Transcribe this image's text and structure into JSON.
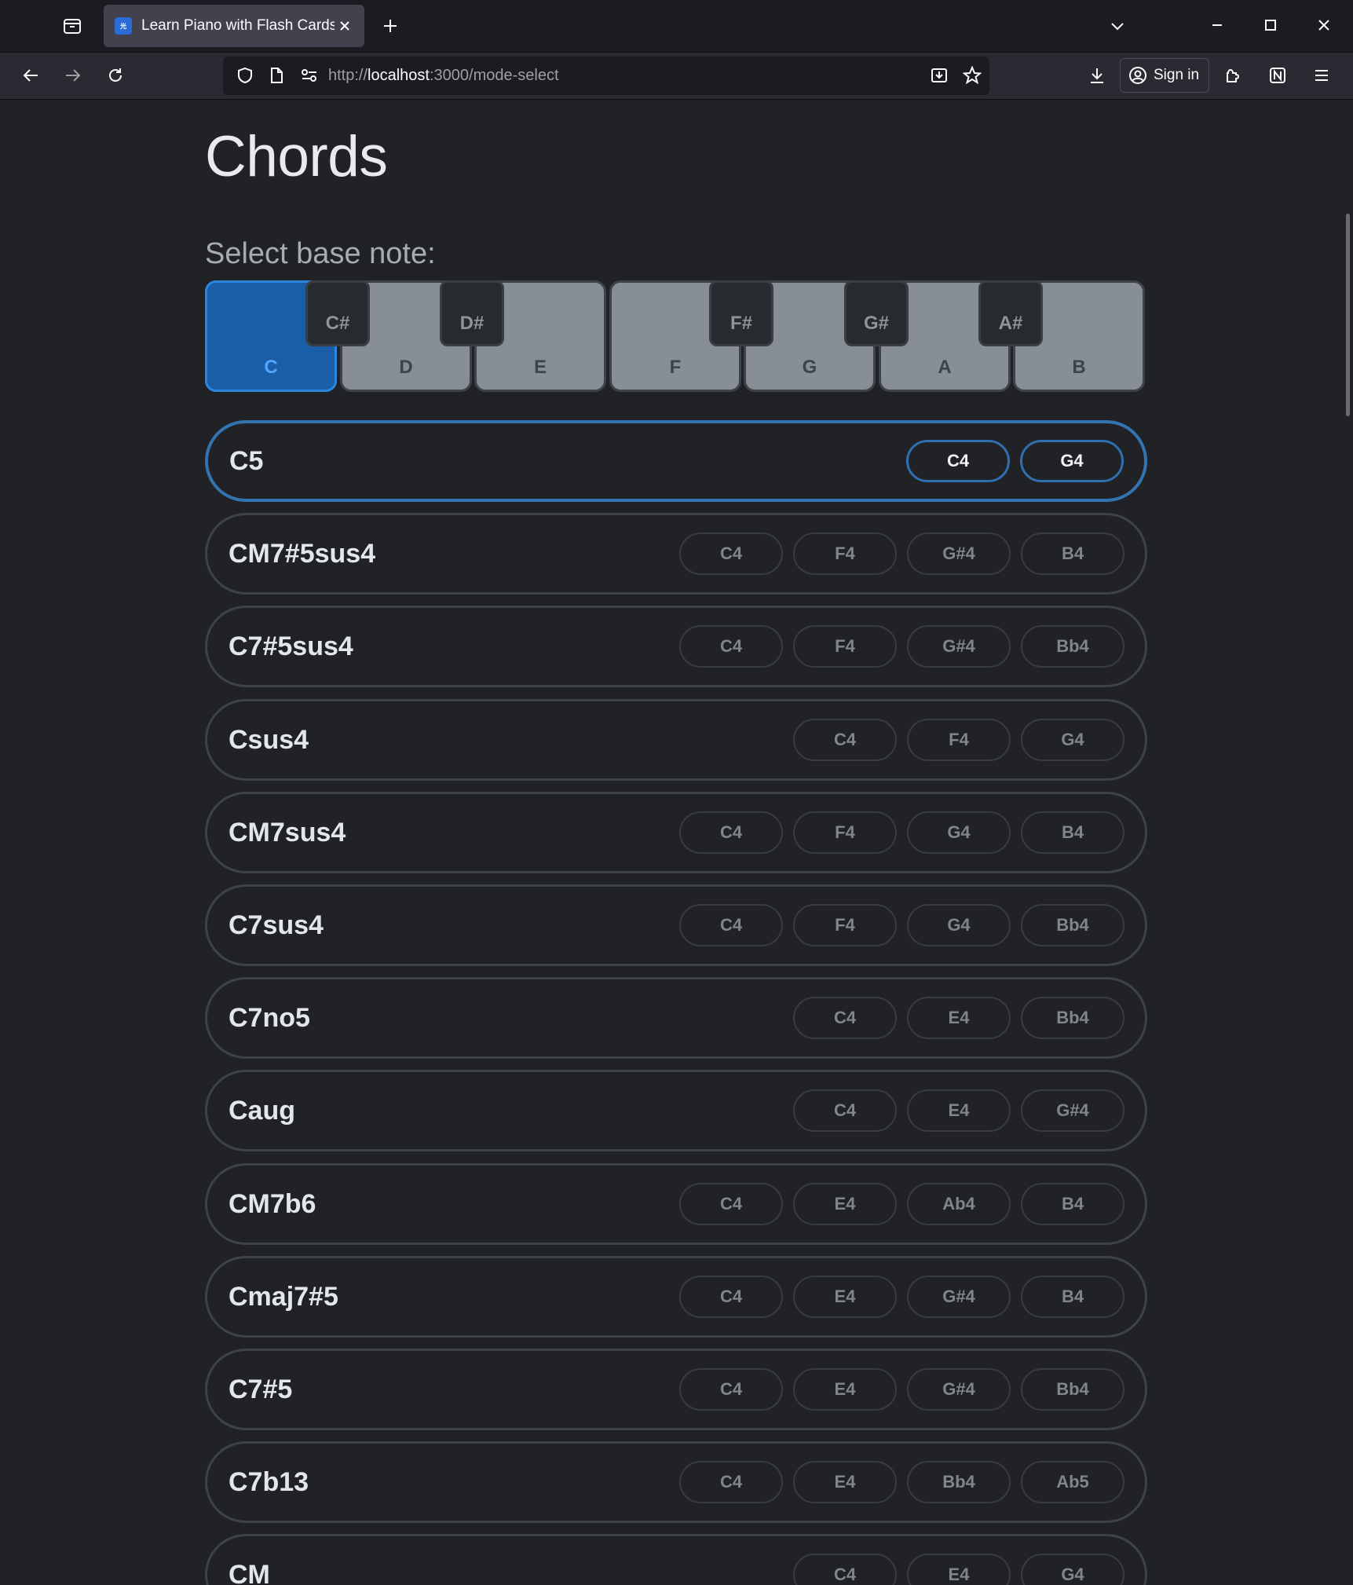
{
  "browser": {
    "tab_title": "Learn Piano with Flash Cards",
    "favicon_text": "光",
    "url_prefix": "http://",
    "url_host": "localhost",
    "url_rest": ":3000/mode-select",
    "signin_label": "Sign in"
  },
  "page": {
    "title": "Chords",
    "base_note_label": "Select base note:",
    "selected_base_note": "C"
  },
  "piano": {
    "white_keys": [
      "C",
      "D",
      "E",
      "F",
      "G",
      "A",
      "B"
    ],
    "black_keys": [
      "C#",
      "D#",
      "F#",
      "G#",
      "A#"
    ]
  },
  "chords": [
    {
      "name": "C5",
      "notes": [
        "C4",
        "G4"
      ],
      "selected": true
    },
    {
      "name": "CM7#5sus4",
      "notes": [
        "C4",
        "F4",
        "G#4",
        "B4"
      ]
    },
    {
      "name": "C7#5sus4",
      "notes": [
        "C4",
        "F4",
        "G#4",
        "Bb4"
      ]
    },
    {
      "name": "Csus4",
      "notes": [
        "C4",
        "F4",
        "G4"
      ]
    },
    {
      "name": "CM7sus4",
      "notes": [
        "C4",
        "F4",
        "G4",
        "B4"
      ]
    },
    {
      "name": "C7sus4",
      "notes": [
        "C4",
        "F4",
        "G4",
        "Bb4"
      ]
    },
    {
      "name": "C7no5",
      "notes": [
        "C4",
        "E4",
        "Bb4"
      ]
    },
    {
      "name": "Caug",
      "notes": [
        "C4",
        "E4",
        "G#4"
      ]
    },
    {
      "name": "CM7b6",
      "notes": [
        "C4",
        "E4",
        "Ab4",
        "B4"
      ]
    },
    {
      "name": "Cmaj7#5",
      "notes": [
        "C4",
        "E4",
        "G#4",
        "B4"
      ]
    },
    {
      "name": "C7#5",
      "notes": [
        "C4",
        "E4",
        "G#4",
        "Bb4"
      ]
    },
    {
      "name": "C7b13",
      "notes": [
        "C4",
        "E4",
        "Bb4",
        "Ab5"
      ]
    },
    {
      "name": "CM",
      "notes": [
        "C4",
        "E4",
        "G4"
      ]
    }
  ],
  "colors": {
    "background": "#202226",
    "selected_accent": "#1a5ea7",
    "selected_border": "#3374b0"
  }
}
